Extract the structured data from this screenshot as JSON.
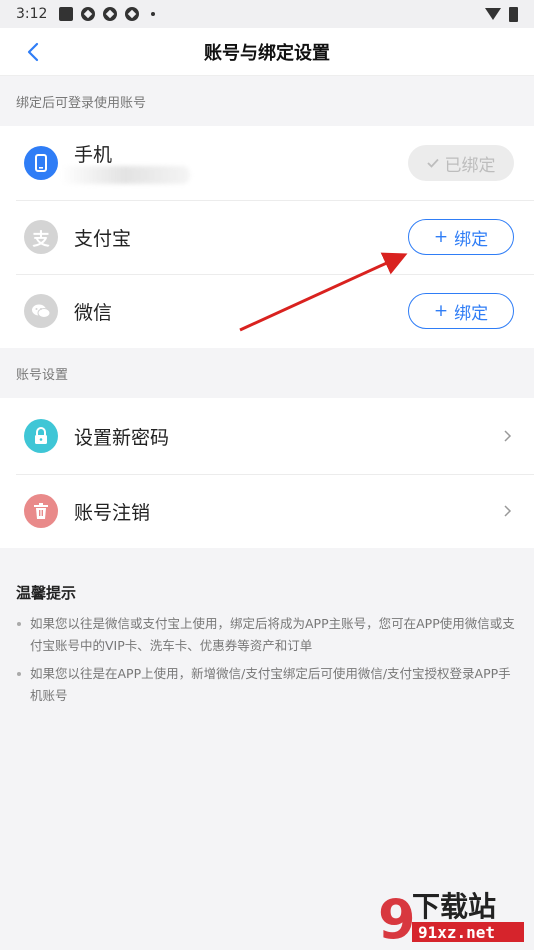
{
  "status_bar": {
    "time": "3:12"
  },
  "nav": {
    "title": "账号与绑定设置",
    "back_icon": "chevron-left-icon"
  },
  "bind_section": {
    "label": "绑定后可登录使用账号",
    "items": [
      {
        "label": "手机",
        "icon": "phone-icon",
        "icon_color": "#2f7df6",
        "button": "已绑定",
        "bound": true
      },
      {
        "label": "支付宝",
        "icon": "alipay-icon",
        "icon_color": "#d4d4d4",
        "button": "绑定",
        "bound": false
      },
      {
        "label": "微信",
        "icon": "wechat-icon",
        "icon_color": "#d4d4d4",
        "button": "绑定",
        "bound": false
      }
    ]
  },
  "account_section": {
    "label": "账号设置",
    "items": [
      {
        "label": "设置新密码",
        "icon": "lock-icon",
        "icon_color": "#3fc6d6"
      },
      {
        "label": "账号注销",
        "icon": "trash-icon",
        "icon_color": "#e98a8a"
      }
    ]
  },
  "tips": {
    "title": "温馨提示",
    "items": [
      "如果您以往是微信或支付宝上使用，绑定后将成为APP主账号，您可在APP使用微信或支付宝账号中的VIP卡、洗车卡、优惠券等资产和订单",
      "如果您以往是在APP上使用，新增微信/支付宝绑定后可使用微信/支付宝授权登录APP手机账号"
    ]
  },
  "watermark": {
    "brand": "下载站",
    "site": "91xz.net"
  },
  "colors": {
    "accent": "#2f7df6",
    "annotation_arrow": "#d9221f",
    "watermark": "#d6242c"
  }
}
